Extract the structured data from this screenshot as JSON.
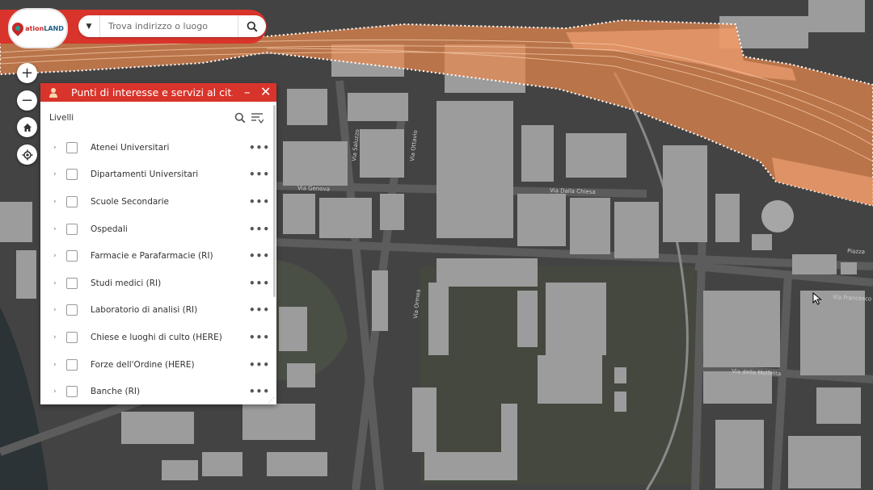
{
  "header": {
    "logo_text_left": "ation",
    "logo_text_right": "LAND",
    "search_placeholder": "Trova indirizzo o luogo"
  },
  "map_controls": {
    "zoom_in": "+",
    "zoom_out": "−"
  },
  "panel": {
    "title": "Punti di interesse e servizi al cit...",
    "layers_label": "Livelli",
    "minimize": "–",
    "close": "✕",
    "layers": [
      {
        "label": "Atenei Universitari"
      },
      {
        "label": "Dipartamenti Universitari"
      },
      {
        "label": "Scuole Secondarie"
      },
      {
        "label": "Ospedali"
      },
      {
        "label": "Farmacie e Parafarmacie (RI)"
      },
      {
        "label": "Studi medici (RI)"
      },
      {
        "label": "Laboratorio di analisi (RI)"
      },
      {
        "label": "Chiese e luoghi di culto (HERE)"
      },
      {
        "label": "Forze dell'Ordine (HERE)"
      },
      {
        "label": "Banche (RI)"
      }
    ]
  },
  "map_labels": {
    "via_ormea": "Via Ormea",
    "via_ottavio": "Via Ottavio",
    "via_dalla_chiesa": "Via Dalla Chiesa",
    "via_saluzzo": "Via Saluzzo",
    "via_genova": "Via Genova",
    "via_molfetta": "Via della Molfetta",
    "via_francesco": "Via Francesco",
    "piazza": "Piazza"
  },
  "colors": {
    "accent": "#d9342b",
    "railway_highlight": "#e8884d"
  }
}
